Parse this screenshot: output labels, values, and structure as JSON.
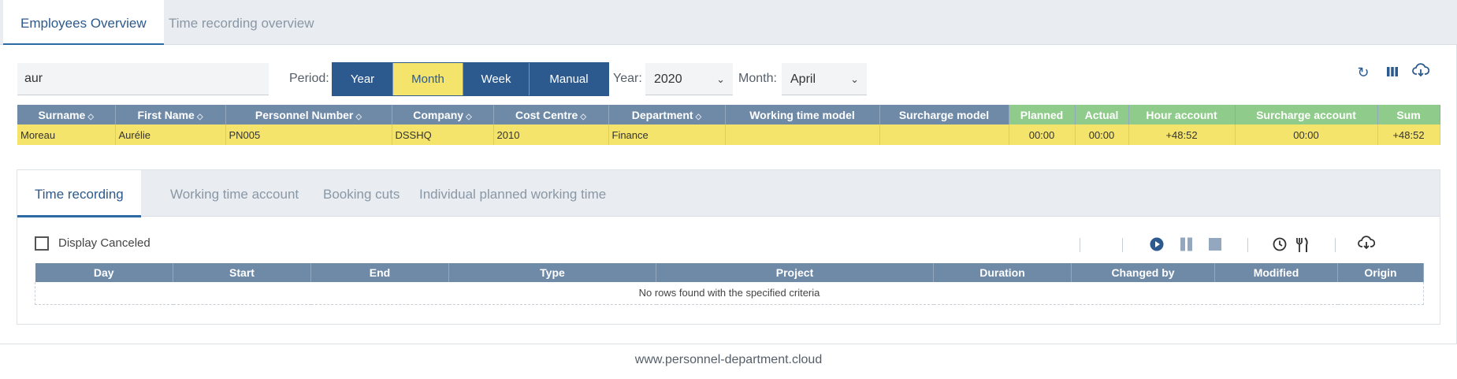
{
  "top_tabs": [
    {
      "label": "Employees Overview",
      "active": true
    },
    {
      "label": "Time recording overview",
      "active": false
    }
  ],
  "search": {
    "value": "aur"
  },
  "period": {
    "label": "Period:",
    "options": [
      "Year",
      "Month",
      "Week",
      "Manual"
    ],
    "selected": "Month"
  },
  "year": {
    "label": "Year:",
    "value": "2020"
  },
  "month": {
    "label": "Month:",
    "value": "April"
  },
  "toolbar_icons": [
    "refresh-icon",
    "columns-icon",
    "cloud-download-icon"
  ],
  "employee_table": {
    "columns": [
      "Surname",
      "First Name",
      "Personnel Number",
      "Company",
      "Cost Centre",
      "Department",
      "Working time model",
      "Surcharge model",
      "Planned",
      "Actual",
      "Hour account",
      "Surcharge account",
      "Sum"
    ],
    "rows": [
      [
        "Moreau",
        "Aurélie",
        "PN005",
        "DSSHQ",
        "2010",
        "Finance",
        "",
        "",
        "00:00",
        "00:00",
        "+48:52",
        "00:00",
        "+48:52"
      ]
    ]
  },
  "sub_tabs": [
    {
      "label": "Time recording",
      "active": true
    },
    {
      "label": "Working time account",
      "active": false
    },
    {
      "label": "Booking cuts",
      "active": false
    },
    {
      "label": "Individual planned working time",
      "active": false
    }
  ],
  "display_canceled": {
    "label": "Display Canceled",
    "checked": false
  },
  "time_toolbar_icons": [
    "play-icon",
    "pause-icon",
    "stop-icon",
    "clock-icon",
    "cutlery-icon",
    "cloud-download-icon"
  ],
  "time_table": {
    "columns": [
      "Day",
      "Start",
      "End",
      "Type",
      "Project",
      "Duration",
      "Changed by",
      "Modified",
      "Origin"
    ],
    "empty_message": "No rows found with the specified criteria"
  },
  "footer": {
    "text": "www.personnel-department.cloud"
  },
  "colors": {
    "primary": "#2c5a8f",
    "highlight": "#f4e46c",
    "header": "#6f8aa7",
    "header_green": "#8fcb8a"
  }
}
